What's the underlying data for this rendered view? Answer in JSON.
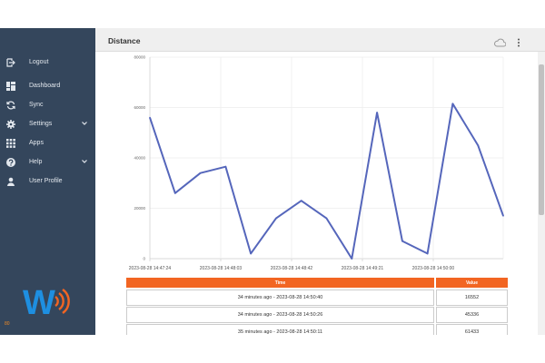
{
  "page": {
    "title": "Distance"
  },
  "sidebar": {
    "items": [
      {
        "label": "Logout",
        "icon": "logout-icon"
      },
      {
        "label": "Dashboard",
        "icon": "dashboard-icon"
      },
      {
        "label": "Sync",
        "icon": "sync-icon"
      },
      {
        "label": "Settings",
        "icon": "gear-icon",
        "expandable": true
      },
      {
        "label": "Apps",
        "icon": "apps-grid-icon"
      },
      {
        "label": "Help",
        "icon": "help-icon",
        "expandable": true
      },
      {
        "label": "User Profile",
        "icon": "user-icon"
      }
    ],
    "brand_logo": "W",
    "corner_text": "80"
  },
  "header": {
    "cloud_icon": "cloud-icon",
    "menu_icon": "kebab-menu-icon"
  },
  "colors": {
    "sidebar_bg": "#34465c",
    "line": "#5566bb",
    "table_header": "#f26522",
    "logo_blue": "#1e8fe1",
    "logo_orange": "#f26522"
  },
  "chart_data": {
    "type": "line",
    "title": "",
    "xlabel": "",
    "ylabel": "",
    "ylim": [
      0,
      80000
    ],
    "yticks": [
      "0",
      "20000",
      "40000",
      "60000",
      "80000"
    ],
    "xtick_labels": [
      "2023-08-28 14:47:24",
      "2023-08-28 14:48:03",
      "2023-08-28 14:48:42",
      "2023-08-28 14:49:21",
      "2023-08-28 14:50:00"
    ],
    "grid": true,
    "series": [
      {
        "values": [
          56000,
          26000,
          34000,
          36500,
          2000,
          16000,
          23000,
          16000,
          0,
          58000,
          7000,
          2000,
          61500,
          45000,
          17000
        ]
      }
    ]
  },
  "table": {
    "columns": [
      "Time",
      "Value"
    ],
    "rows": [
      {
        "time": "34 minutes ago - 2023-08-28 14:50:40",
        "value": "16552"
      },
      {
        "time": "34 minutes ago - 2023-08-28 14:50:26",
        "value": "45336"
      },
      {
        "time": "35 minutes ago - 2023-08-28 14:50:11",
        "value": "61433"
      }
    ]
  }
}
